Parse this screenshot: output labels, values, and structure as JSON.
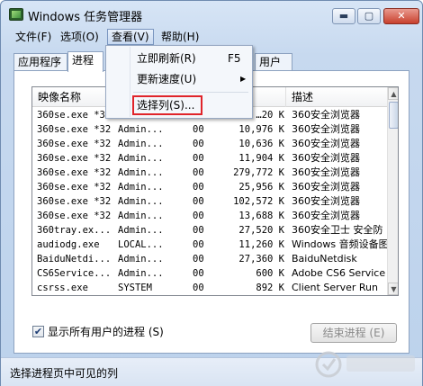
{
  "window": {
    "title": "Windows 任务管理器",
    "min_glyph": "▬",
    "max_glyph": "▢",
    "close_glyph": "✕",
    "icon": "task-manager-icon"
  },
  "menubar": {
    "file": "文件(F)",
    "options": "选项(O)",
    "view": "查看(V)",
    "help": "帮助(H)"
  },
  "tabs": {
    "apps": "应用程序",
    "processes": "进程",
    "users_partial": "用户"
  },
  "view_menu": {
    "refresh_now": "立即刷新(R)",
    "refresh_shortcut": "F5",
    "update_speed": "更新速度(U)",
    "submenu_arrow": "▶",
    "select_columns": "选择列(S)..."
  },
  "table": {
    "headers": {
      "image_name": "映像名称",
      "user": "",
      "cpu": "",
      "memory": "用...",
      "description": "描述"
    },
    "rows": [
      {
        "name": "360se.exe *32",
        "user": "Admin...",
        "cpu": "00",
        "mem": "…20 K",
        "desc": "360安全浏览器"
      },
      {
        "name": "360se.exe *32",
        "user": "Admin...",
        "cpu": "00",
        "mem": "10,976 K",
        "desc": "360安全浏览器"
      },
      {
        "name": "360se.exe *32",
        "user": "Admin...",
        "cpu": "00",
        "mem": "10,636 K",
        "desc": "360安全浏览器"
      },
      {
        "name": "360se.exe *32",
        "user": "Admin...",
        "cpu": "00",
        "mem": "11,904 K",
        "desc": "360安全浏览器"
      },
      {
        "name": "360se.exe *32",
        "user": "Admin...",
        "cpu": "00",
        "mem": "279,772 K",
        "desc": "360安全浏览器"
      },
      {
        "name": "360se.exe *32",
        "user": "Admin...",
        "cpu": "00",
        "mem": "25,956 K",
        "desc": "360安全浏览器"
      },
      {
        "name": "360se.exe *32",
        "user": "Admin...",
        "cpu": "00",
        "mem": "102,572 K",
        "desc": "360安全浏览器"
      },
      {
        "name": "360se.exe *32",
        "user": "Admin...",
        "cpu": "00",
        "mem": "13,688 K",
        "desc": "360安全浏览器"
      },
      {
        "name": "360tray.ex...",
        "user": "Admin...",
        "cpu": "00",
        "mem": "27,520 K",
        "desc": "360安全卫士 安全防"
      },
      {
        "name": "audiodg.exe",
        "user": "LOCAL...",
        "cpu": "00",
        "mem": "11,260 K",
        "desc": "Windows 音频设备图"
      },
      {
        "name": "BaiduNetdi...",
        "user": "Admin...",
        "cpu": "00",
        "mem": "27,360 K",
        "desc": "BaiduNetdisk"
      },
      {
        "name": "CS6Service...",
        "user": "Admin...",
        "cpu": "00",
        "mem": "600 K",
        "desc": "Adobe CS6 Service"
      },
      {
        "name": "csrss.exe",
        "user": "SYSTEM",
        "cpu": "00",
        "mem": "892 K",
        "desc": "Client Server Run"
      },
      {
        "name": "csrss.exe",
        "user": "SYSTEM",
        "cpu": "00",
        "mem": "2,040 K",
        "desc": "Client Server Run"
      }
    ]
  },
  "show_all_users": {
    "checked_glyph": "✔",
    "label": "显示所有用户的进程 (S)"
  },
  "end_process_button": "结束进程 (E)",
  "statusbar": {
    "text": "选择进程页中可见的列"
  },
  "scrollbar": {
    "up": "▲",
    "down": "▼"
  },
  "colors": {
    "highlight": "#e0242a",
    "window_frame": "#6f8bb0"
  }
}
